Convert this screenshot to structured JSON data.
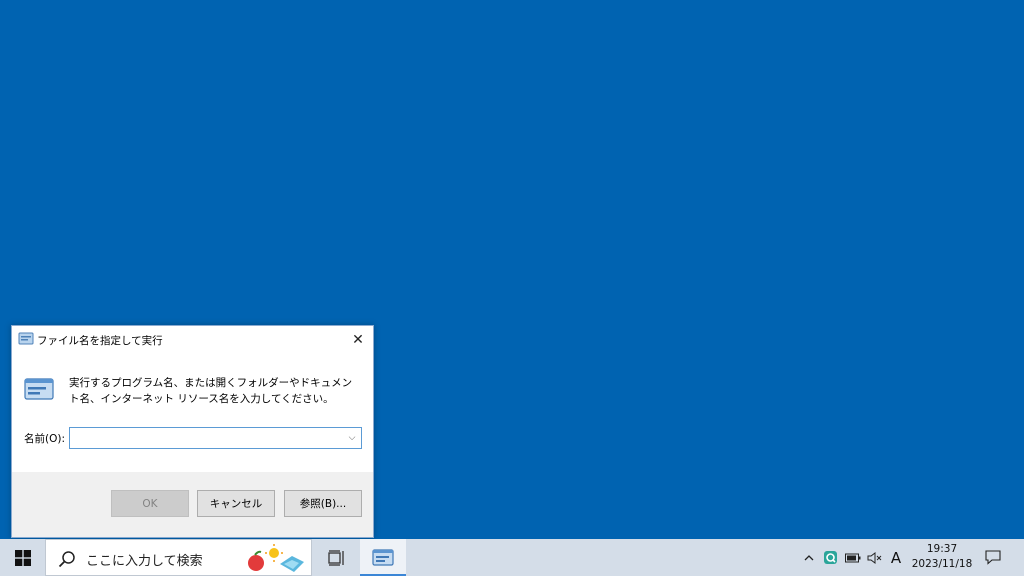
{
  "dialog": {
    "title": "ファイル名を指定して実行",
    "description": "実行するプログラム名、または開くフォルダーやドキュメント名、インターネット リソース名を入力してください。",
    "open_label": "名前(O):",
    "open_value": "",
    "ok_label": "OK",
    "cancel_label": "キャンセル",
    "browse_label": "参照(B)..."
  },
  "taskbar": {
    "search_placeholder": "ここに入力して検索",
    "ime_mode": "A",
    "time": "19:37",
    "date": "2023/11/18"
  },
  "icons": {
    "start": "windows-logo-icon",
    "search": "search-icon",
    "task_view": "task-view-icon",
    "run": "run-app-icon",
    "tray": [
      "chevron-up-icon",
      "security-icon",
      "battery-icon",
      "speaker-muted-icon"
    ],
    "notifications": "action-center-icon"
  },
  "colors": {
    "desktop": "#0063b1",
    "taskbar": "#d4dde8",
    "accent": "#5b9bd5"
  }
}
